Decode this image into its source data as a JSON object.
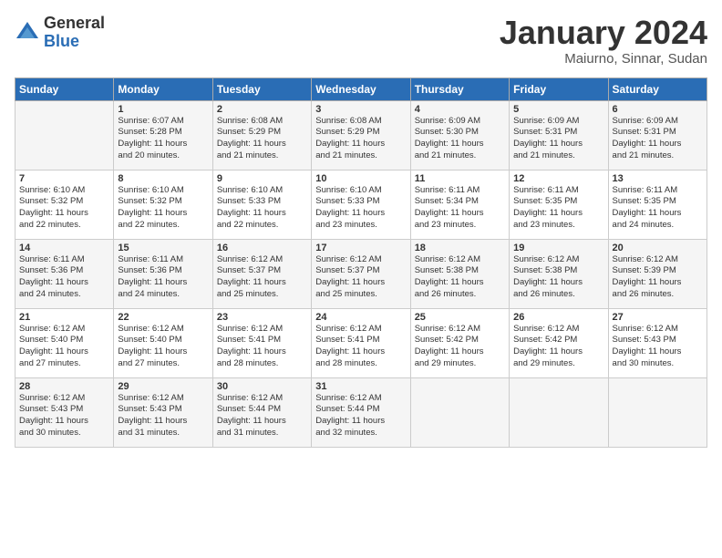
{
  "header": {
    "logo_general": "General",
    "logo_blue": "Blue",
    "month_title": "January 2024",
    "location": "Maiurno, Sinnar, Sudan"
  },
  "days_of_week": [
    "Sunday",
    "Monday",
    "Tuesday",
    "Wednesday",
    "Thursday",
    "Friday",
    "Saturday"
  ],
  "weeks": [
    [
      {
        "day": "",
        "info": ""
      },
      {
        "day": "1",
        "info": "Sunrise: 6:07 AM\nSunset: 5:28 PM\nDaylight: 11 hours\nand 20 minutes."
      },
      {
        "day": "2",
        "info": "Sunrise: 6:08 AM\nSunset: 5:29 PM\nDaylight: 11 hours\nand 21 minutes."
      },
      {
        "day": "3",
        "info": "Sunrise: 6:08 AM\nSunset: 5:29 PM\nDaylight: 11 hours\nand 21 minutes."
      },
      {
        "day": "4",
        "info": "Sunrise: 6:09 AM\nSunset: 5:30 PM\nDaylight: 11 hours\nand 21 minutes."
      },
      {
        "day": "5",
        "info": "Sunrise: 6:09 AM\nSunset: 5:31 PM\nDaylight: 11 hours\nand 21 minutes."
      },
      {
        "day": "6",
        "info": "Sunrise: 6:09 AM\nSunset: 5:31 PM\nDaylight: 11 hours\nand 21 minutes."
      }
    ],
    [
      {
        "day": "7",
        "info": "Sunrise: 6:10 AM\nSunset: 5:32 PM\nDaylight: 11 hours\nand 22 minutes."
      },
      {
        "day": "8",
        "info": "Sunrise: 6:10 AM\nSunset: 5:32 PM\nDaylight: 11 hours\nand 22 minutes."
      },
      {
        "day": "9",
        "info": "Sunrise: 6:10 AM\nSunset: 5:33 PM\nDaylight: 11 hours\nand 22 minutes."
      },
      {
        "day": "10",
        "info": "Sunrise: 6:10 AM\nSunset: 5:33 PM\nDaylight: 11 hours\nand 23 minutes."
      },
      {
        "day": "11",
        "info": "Sunrise: 6:11 AM\nSunset: 5:34 PM\nDaylight: 11 hours\nand 23 minutes."
      },
      {
        "day": "12",
        "info": "Sunrise: 6:11 AM\nSunset: 5:35 PM\nDaylight: 11 hours\nand 23 minutes."
      },
      {
        "day": "13",
        "info": "Sunrise: 6:11 AM\nSunset: 5:35 PM\nDaylight: 11 hours\nand 24 minutes."
      }
    ],
    [
      {
        "day": "14",
        "info": "Sunrise: 6:11 AM\nSunset: 5:36 PM\nDaylight: 11 hours\nand 24 minutes."
      },
      {
        "day": "15",
        "info": "Sunrise: 6:11 AM\nSunset: 5:36 PM\nDaylight: 11 hours\nand 24 minutes."
      },
      {
        "day": "16",
        "info": "Sunrise: 6:12 AM\nSunset: 5:37 PM\nDaylight: 11 hours\nand 25 minutes."
      },
      {
        "day": "17",
        "info": "Sunrise: 6:12 AM\nSunset: 5:37 PM\nDaylight: 11 hours\nand 25 minutes."
      },
      {
        "day": "18",
        "info": "Sunrise: 6:12 AM\nSunset: 5:38 PM\nDaylight: 11 hours\nand 26 minutes."
      },
      {
        "day": "19",
        "info": "Sunrise: 6:12 AM\nSunset: 5:38 PM\nDaylight: 11 hours\nand 26 minutes."
      },
      {
        "day": "20",
        "info": "Sunrise: 6:12 AM\nSunset: 5:39 PM\nDaylight: 11 hours\nand 26 minutes."
      }
    ],
    [
      {
        "day": "21",
        "info": "Sunrise: 6:12 AM\nSunset: 5:40 PM\nDaylight: 11 hours\nand 27 minutes."
      },
      {
        "day": "22",
        "info": "Sunrise: 6:12 AM\nSunset: 5:40 PM\nDaylight: 11 hours\nand 27 minutes."
      },
      {
        "day": "23",
        "info": "Sunrise: 6:12 AM\nSunset: 5:41 PM\nDaylight: 11 hours\nand 28 minutes."
      },
      {
        "day": "24",
        "info": "Sunrise: 6:12 AM\nSunset: 5:41 PM\nDaylight: 11 hours\nand 28 minutes."
      },
      {
        "day": "25",
        "info": "Sunrise: 6:12 AM\nSunset: 5:42 PM\nDaylight: 11 hours\nand 29 minutes."
      },
      {
        "day": "26",
        "info": "Sunrise: 6:12 AM\nSunset: 5:42 PM\nDaylight: 11 hours\nand 29 minutes."
      },
      {
        "day": "27",
        "info": "Sunrise: 6:12 AM\nSunset: 5:43 PM\nDaylight: 11 hours\nand 30 minutes."
      }
    ],
    [
      {
        "day": "28",
        "info": "Sunrise: 6:12 AM\nSunset: 5:43 PM\nDaylight: 11 hours\nand 30 minutes."
      },
      {
        "day": "29",
        "info": "Sunrise: 6:12 AM\nSunset: 5:43 PM\nDaylight: 11 hours\nand 31 minutes."
      },
      {
        "day": "30",
        "info": "Sunrise: 6:12 AM\nSunset: 5:44 PM\nDaylight: 11 hours\nand 31 minutes."
      },
      {
        "day": "31",
        "info": "Sunrise: 6:12 AM\nSunset: 5:44 PM\nDaylight: 11 hours\nand 32 minutes."
      },
      {
        "day": "",
        "info": ""
      },
      {
        "day": "",
        "info": ""
      },
      {
        "day": "",
        "info": ""
      }
    ]
  ]
}
